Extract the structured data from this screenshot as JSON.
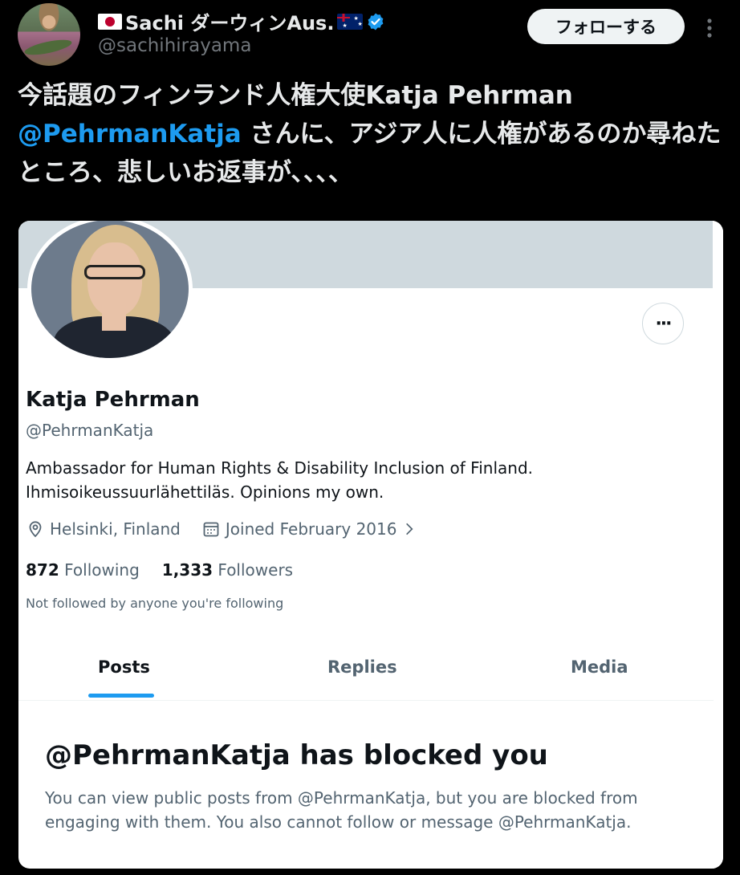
{
  "tweet": {
    "author_name": "Sachi ダーウィンAus.",
    "author_handle": "@sachihirayama",
    "follow_label": "フォローする",
    "text_part1": "今話題のフィンランド人権大使Katja Pehrman ",
    "text_mention": "@PehrmanKatja",
    "text_part2": " さんに、アジア人に人権があるのか尋ねたところ、悲しいお返事が、、、、"
  },
  "profile": {
    "name": "Katja Pehrman",
    "handle": "@PehrmanKatja",
    "bio": "Ambassador for Human Rights & Disability Inclusion of Finland.\nIhmisoikeussuurlähettiläs. Opinions my own.",
    "location": "Helsinki, Finland",
    "joined": "Joined February 2016",
    "following_count": "872",
    "following_label": "Following",
    "followers_count": "1,333",
    "followers_label": "Followers",
    "not_followed_note": "Not followed by anyone you're following",
    "more_label": "···"
  },
  "tabs": [
    {
      "label": "Posts",
      "active": true
    },
    {
      "label": "Replies",
      "active": false
    },
    {
      "label": "Media",
      "active": false
    }
  ],
  "blocked": {
    "title": "@PehrmanKatja has blocked you",
    "description": "You can view public posts from @PehrmanKatja, but you are blocked from engaging with them. You also cannot follow or message @PehrmanKatja."
  },
  "colors": {
    "accent": "#1d9bf0",
    "background": "#000000",
    "card": "#ffffff",
    "banner": "#cfd9de"
  }
}
